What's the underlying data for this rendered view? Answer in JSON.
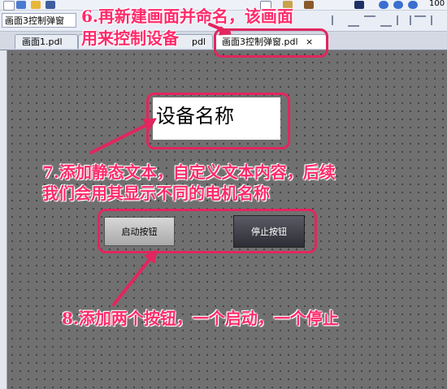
{
  "toolbar": {
    "title_box": "画面3控制弹窗",
    "zoom": "100"
  },
  "tabs": [
    {
      "label": "画面1.pdl"
    },
    {
      "label": "pdl"
    },
    {
      "label": "画面3控制弹窗.pdl",
      "close": "×"
    }
  ],
  "canvas": {
    "static_text": "设备名称",
    "button_start": "启动按钮",
    "button_stop": "停止按钮"
  },
  "annotations": {
    "step6_line1": "6.再新建画面并命名，该画面",
    "step6_line2": "用来控制设备",
    "step7_line1": "7.添加静态文本，自定义文本内容，后续",
    "step7_line2": "我们会用其显示不同的电机名称",
    "step8": "8.添加两个按钮，一个启动，一个停止"
  },
  "colors": {
    "annotation": "#ff2a6a",
    "canvas": "#707070"
  }
}
